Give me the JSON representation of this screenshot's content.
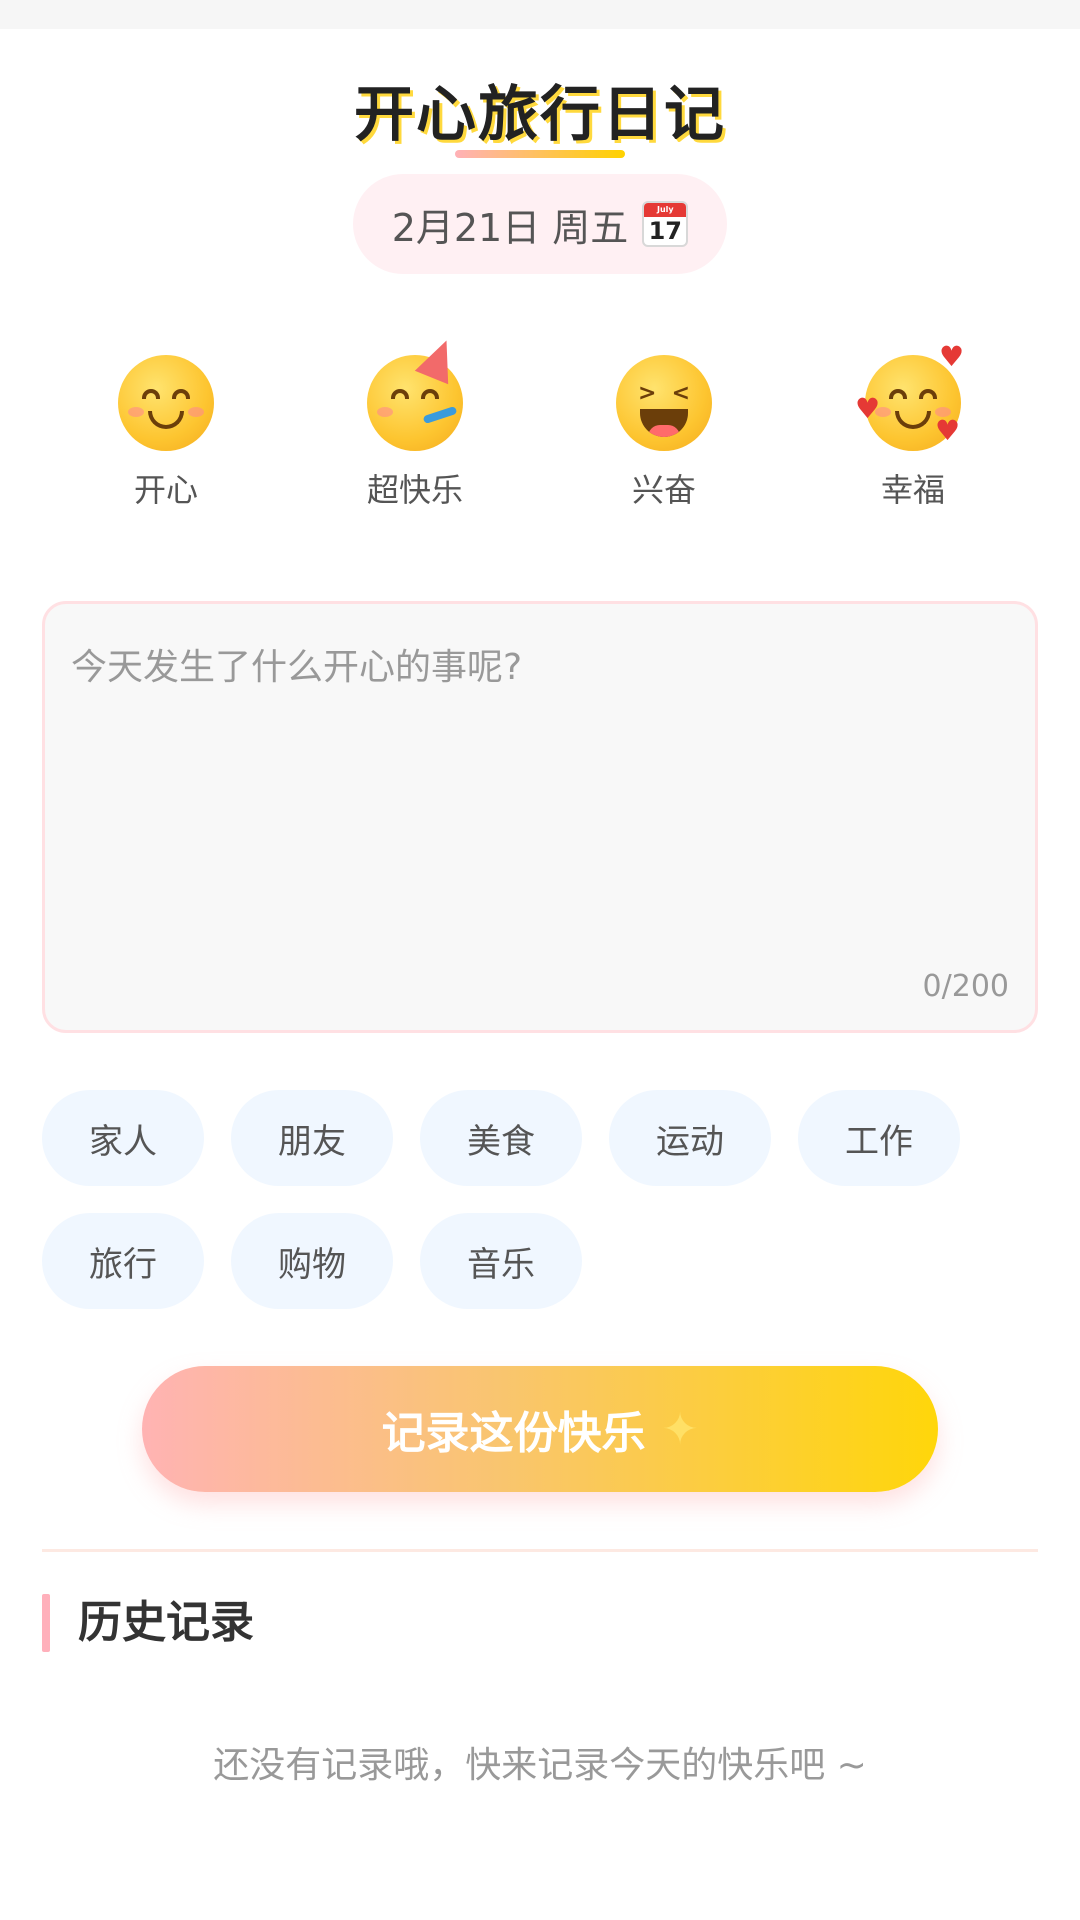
{
  "header": {
    "title": "开心旅行日记",
    "date": "2月21日 周五",
    "calendar_icon": {
      "name": "calendar-icon",
      "month": "July",
      "day": "17"
    }
  },
  "moods": [
    {
      "id": "happy",
      "label": "开心",
      "icon": "smiling-face-icon"
    },
    {
      "id": "super-happy",
      "label": "超快乐",
      "icon": "party-face-icon"
    },
    {
      "id": "excited",
      "label": "兴奋",
      "icon": "grinning-squint-face-icon"
    },
    {
      "id": "blessed",
      "label": "幸福",
      "icon": "smiling-face-hearts-icon"
    }
  ],
  "entry": {
    "placeholder": "今天发生了什么开心的事呢?",
    "value": "",
    "count": "0/200"
  },
  "tags": [
    "家人",
    "朋友",
    "美食",
    "运动",
    "工作",
    "旅行",
    "购物",
    "音乐"
  ],
  "submit": {
    "label": "记录这份快乐",
    "icon": "sparkles-icon"
  },
  "history": {
    "title": "历史记录",
    "empty_text": "还没有记录哦，快来记录今天的快乐吧 ~"
  },
  "colors": {
    "accent_pink": "#ffb0bb",
    "accent_yellow": "#ffd60a",
    "tag_bg": "#f0f7ff",
    "date_bg": "#fff0f3"
  }
}
